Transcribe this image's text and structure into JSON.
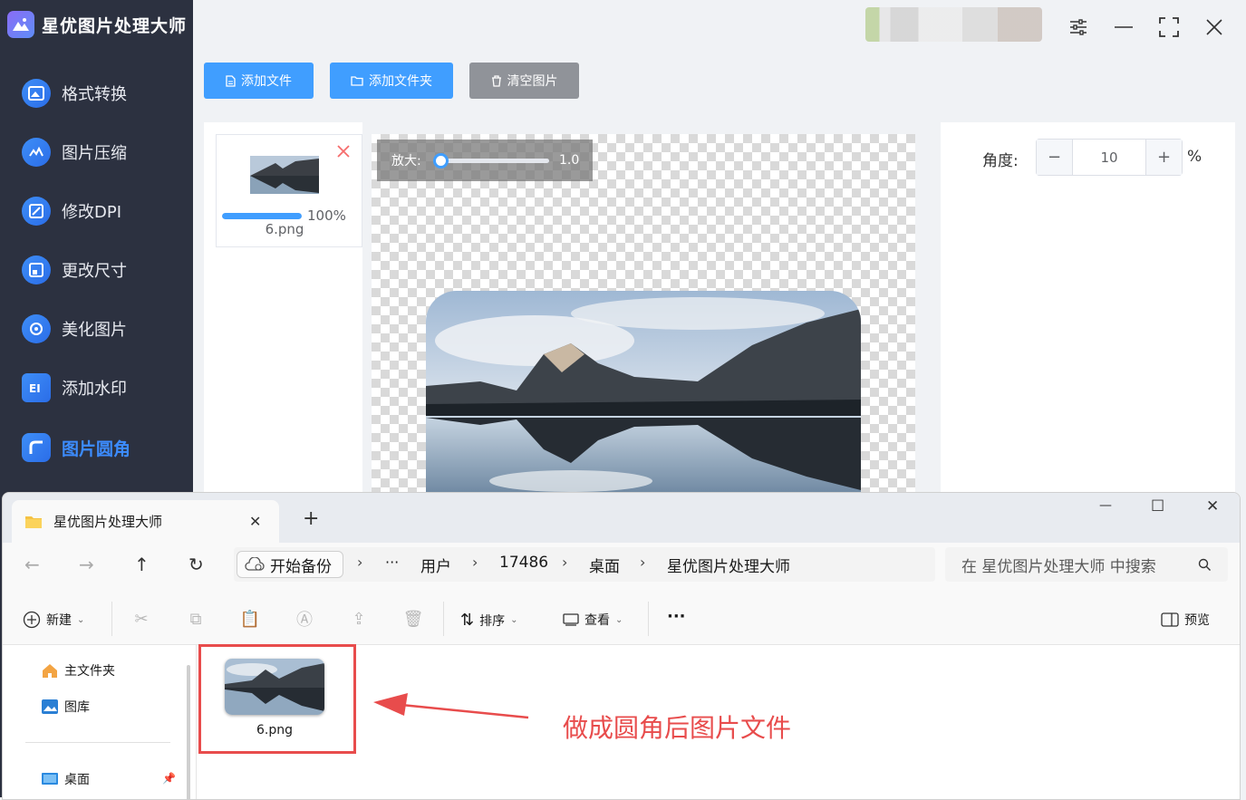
{
  "app": {
    "title": "星优图片处理大师",
    "nav": [
      {
        "label": "格式转换",
        "icon": "image-convert-icon"
      },
      {
        "label": "图片压缩",
        "icon": "image-compress-icon"
      },
      {
        "label": "修改DPI",
        "icon": "dpi-icon"
      },
      {
        "label": "更改尺寸",
        "icon": "resize-icon"
      },
      {
        "label": "美化图片",
        "icon": "beautify-icon"
      },
      {
        "label": "添加水印",
        "icon": "watermark-icon"
      },
      {
        "label": "图片圆角",
        "icon": "round-corner-icon"
      }
    ],
    "active_nav": "图片圆角",
    "toolbar": {
      "add_file": "添加文件",
      "add_folder": "添加文件夹",
      "clear": "清空图片"
    },
    "file": {
      "name": "6.png",
      "progress_text": "100%",
      "progress": 1.0
    },
    "zoom": {
      "label": "放大:",
      "value": "1.0",
      "level": 0.0
    },
    "angle": {
      "label": "角度:",
      "value": "10",
      "unit": "%",
      "minus": "−",
      "plus": "+"
    }
  },
  "explorer": {
    "tab_title": "星优图片处理大师",
    "tab_close": "✕",
    "new_tab": "+",
    "window_controls": {
      "minimize": "—",
      "maximize": "☐",
      "close": "✕"
    },
    "nav_arrows": {
      "back": "←",
      "forward": "→",
      "up": "↑",
      "refresh": "↻"
    },
    "breadcrumb": {
      "backup": "开始备份",
      "more": "···",
      "items": [
        "用户",
        "17486",
        "桌面",
        "星优图片处理大师"
      ]
    },
    "search_placeholder": "在 星优图片处理大师 中搜索",
    "toolbar": {
      "new": "新建",
      "sort": "排序",
      "view": "查看",
      "more": "···",
      "preview": "预览"
    },
    "sidebar": [
      "主文件夹",
      "图库",
      "桌面"
    ],
    "files": [
      {
        "name": "6.png"
      }
    ]
  },
  "annotation": {
    "text": "做成圆角后图片文件",
    "color": "#e84c4c"
  }
}
